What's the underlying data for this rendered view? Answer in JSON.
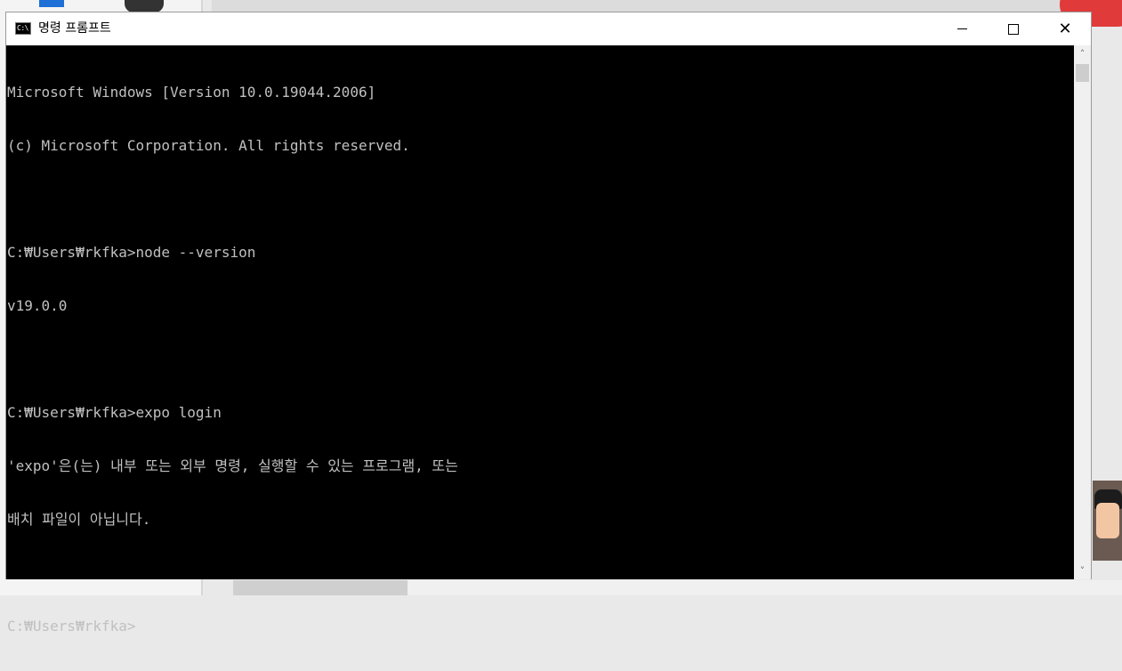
{
  "window": {
    "title": "명령 프롬프트",
    "icon_label": "C:\\",
    "controls": {
      "minimize_icon": "minimize-icon",
      "maximize_icon": "maximize-icon",
      "close_icon": "close-icon",
      "close_glyph": "✕"
    }
  },
  "console": {
    "background": "#000000",
    "foreground": "#c0c0c0",
    "lines": [
      "Microsoft Windows [Version 10.0.19044.2006]",
      "(c) Microsoft Corporation. All rights reserved.",
      "",
      "C:₩Users₩rkfka>node --version",
      "v19.0.0",
      "",
      "C:₩Users₩rkfka>expo login",
      "'expo'은(는) 내부 또는 외부 명령, 실행할 수 있는 프로그램, 또는",
      "배치 파일이 아닙니다.",
      "",
      "C:₩Users₩rkfka>"
    ]
  },
  "scrollbar": {
    "up_arrow": "˄",
    "down_arrow": "˅"
  }
}
